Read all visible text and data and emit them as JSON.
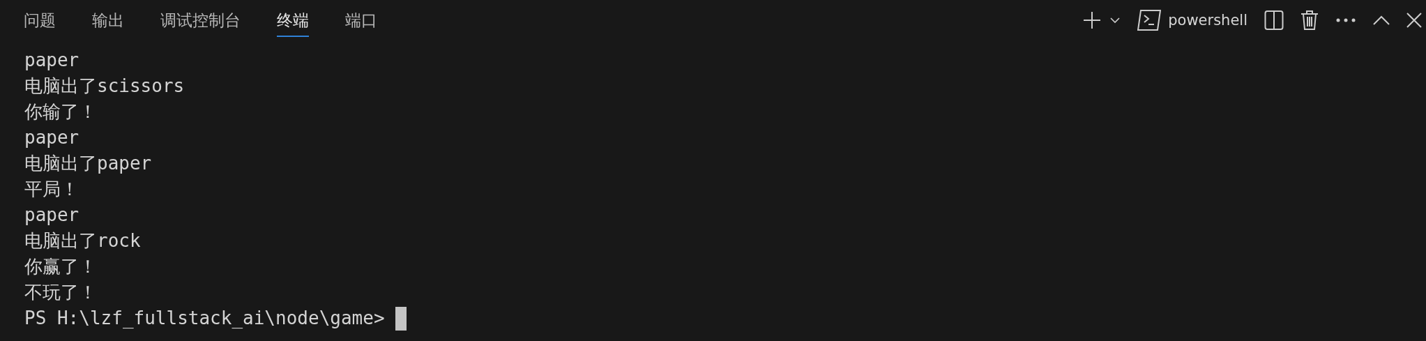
{
  "tabs": [
    {
      "label": "问题",
      "selected": false
    },
    {
      "label": "输出",
      "selected": false
    },
    {
      "label": "调试控制台",
      "selected": false
    },
    {
      "label": "终端",
      "selected": true
    },
    {
      "label": "端口",
      "selected": false
    }
  ],
  "toolbar": {
    "shell_name": "powershell"
  },
  "terminal": {
    "lines": [
      "paper",
      "电脑出了scissors",
      "你输了！",
      "paper",
      "电脑出了paper",
      "平局！",
      "paper",
      "电脑出了rock",
      "你赢了！",
      "不玩了！"
    ],
    "prompt": "PS H:\\lzf_fullstack_ai\\node\\game>"
  }
}
